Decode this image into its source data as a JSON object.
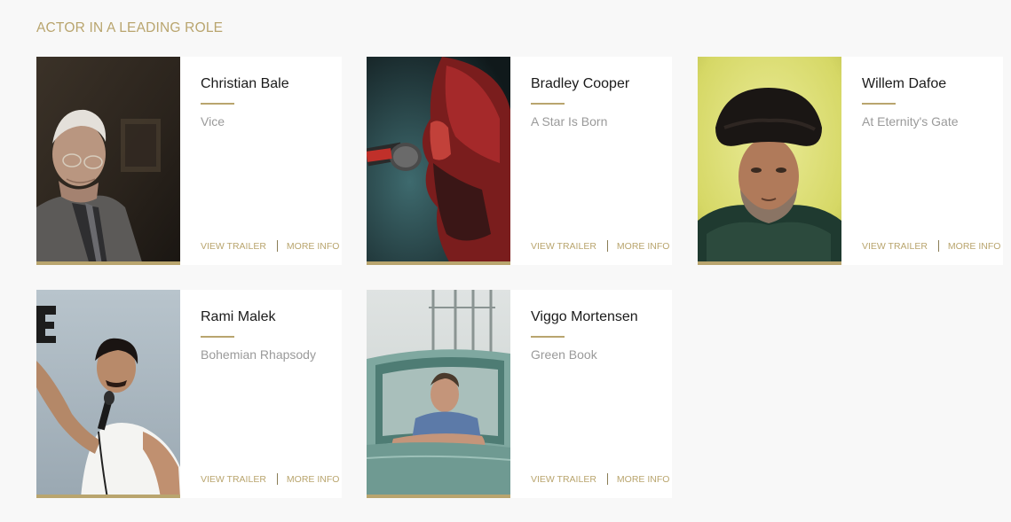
{
  "section": {
    "title": "ACTOR IN A LEADING ROLE"
  },
  "colors": {
    "accent": "#b9a56e",
    "name": "#1a1a1a",
    "film": "#9a9a9a",
    "card_bg": "#ffffff",
    "page_bg": "#f8f8f8"
  },
  "nominees": [
    {
      "name": "Christian Bale",
      "film": "Vice",
      "view_trailer": "VIEW TRAILER",
      "more_info": "MORE INFO",
      "photo_icon": "portrait-christian-bale"
    },
    {
      "name": "Bradley Cooper",
      "film": "A Star Is Born",
      "view_trailer": "VIEW TRAILER",
      "more_info": "MORE INFO",
      "photo_icon": "portrait-bradley-cooper"
    },
    {
      "name": "Willem Dafoe",
      "film": "At Eternity's Gate",
      "view_trailer": "VIEW TRAILER",
      "more_info": "MORE INFO",
      "photo_icon": "portrait-willem-dafoe"
    },
    {
      "name": "Rami Malek",
      "film": "Bohemian Rhapsody",
      "view_trailer": "VIEW TRAILER",
      "more_info": "MORE INFO",
      "photo_icon": "portrait-rami-malek"
    },
    {
      "name": "Viggo Mortensen",
      "film": "Green Book",
      "view_trailer": "VIEW TRAILER",
      "more_info": "MORE INFO",
      "photo_icon": "portrait-viggo-mortensen"
    }
  ]
}
